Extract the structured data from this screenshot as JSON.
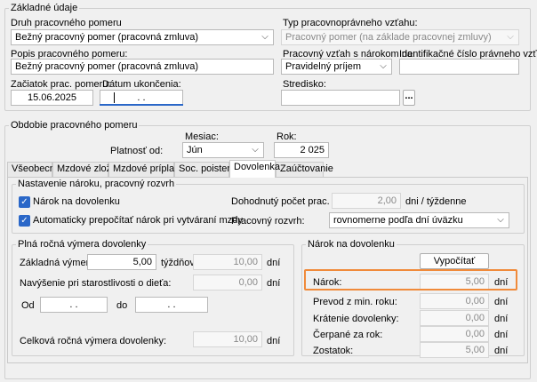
{
  "basic": {
    "title": "Základné údaje",
    "druh_label": "Druh pracovného pomeru",
    "druh_value": "Bežný pracovný pomer (pracovná zmluva)",
    "typ_label": "Typ pracovnoprávneho vzťahu:",
    "typ_value": "Pracovný pomer (na základe pracovnej zmluvy)",
    "popis_label": "Popis pracovného pomeru:",
    "popis_value": "Bežný pracovný pomer (pracovná zmluva)",
    "vztah_label": "Pracovný vzťah s nárokom na:",
    "vztah_value": "Pravidelný príjem",
    "ident_label": "Identifikačné číslo právneho vzťahu:",
    "ident_value": "",
    "zaciatok_label": "Začiatok prac. pomeru:",
    "zaciatok_value": "15.06.2025",
    "ukoncenie_label": "Dátum ukončenia:",
    "ukoncenie_value": ".   .",
    "stredisko_label": "Stredisko:",
    "stredisko_value": "",
    "ellipsis": "..."
  },
  "period": {
    "title": "Obdobie pracovného pomeru",
    "mesiac_label": "Mesiac:",
    "rok_label": "Rok:",
    "platnost_label": "Platnosť od:",
    "mesiac_value": "Jún",
    "rok_value": "2 025"
  },
  "tabs": [
    {
      "label": "Všeobecné"
    },
    {
      "label": "Mzdové zložky"
    },
    {
      "label": "Mzdové príplatky"
    },
    {
      "label": "Soc. poistenie"
    },
    {
      "label": "Dovolenka"
    },
    {
      "label": "Zaúčtovanie"
    }
  ],
  "settings": {
    "title": "Nastavenie nároku, pracovný rozvrh",
    "narok_check": "Nárok na dovolenku",
    "auto_check": "Automaticky prepočítať nárok pri vytváraní mzdy",
    "dohodnuty_label": "Dohodnutý počet prac. dní:",
    "dohodnuty_value": "2,00",
    "dohodnuty_unit": "dni / týždenne",
    "rozvrh_label": "Pracovný rozvrh:",
    "rozvrh_value": "rovnomerne podľa dní úväzku"
  },
  "annual": {
    "title": "Plná ročná výmera dovolenky",
    "zakladna_label": "Základná výmera:",
    "zakladna_value": "5,00",
    "tyzdnov": "týždňov",
    "zakladna_days": "10,00",
    "dni": "dní",
    "navysenie_label": "Navýšenie pri starostlivosti o dieťa:",
    "navysenie_value": "0,00",
    "od_label": "Od",
    "od_value": ".   .",
    "do_label": "do",
    "do_value": ".   .",
    "celkova_label": "Celková ročná výmera dovolenky:",
    "celkova_value": "10,00"
  },
  "entitlement": {
    "title": "Nárok na dovolenku",
    "vypocitat": "Vypočítať",
    "nark_label": "Nárok:",
    "nark_value": "5,00",
    "prevod_label": "Prevod z min. roku:",
    "prevod_value": "0,00",
    "kratenie_label": "Krátenie dovolenky:",
    "kratenie_value": "0,00",
    "cerpane_label": "Čerpané za rok:",
    "cerpane_value": "0,00",
    "zostatok_label": "Zostatok:",
    "zostatok_value": "5,00",
    "dni": "dní"
  },
  "colors": {
    "accent": "#2a67c8",
    "highlight": "#f08a3a"
  }
}
